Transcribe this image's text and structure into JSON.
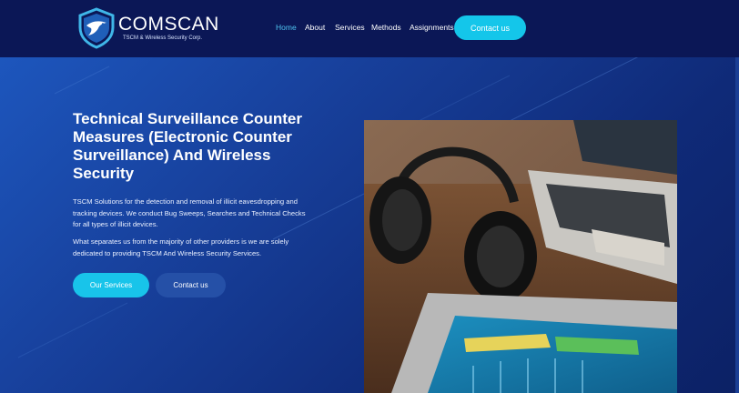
{
  "brand": {
    "name": "COMSCAN",
    "tagline": "TSCM & Wireless Security Corp."
  },
  "nav": {
    "items": [
      "Home",
      "About",
      "Services",
      "Methods",
      "Assignments"
    ],
    "active": "Home",
    "contact_label": "Contact us"
  },
  "hero": {
    "title": "Technical Surveillance Counter Measures (Electronic Counter Surveillance) And Wireless Security",
    "paragraph1": "TSCM Solutions for the detection and removal of illicit eavesdropping and tracking devices. We conduct Bug Sweeps, Searches and Technical Checks for all types of illicit devices.",
    "paragraph2": "What separates us from the majority of other providers is we are solely dedicated to providing TSCM And Wireless Security Services.",
    "primary_button": "Our Services",
    "secondary_button": "Contact us"
  },
  "colors": {
    "header_bg": "#0b1756",
    "accent": "#14c6ea",
    "active_nav": "#4fc4f0",
    "secondary_button": "#2550a7"
  },
  "icons": {
    "logo": "shield-eagle-logo-icon"
  }
}
